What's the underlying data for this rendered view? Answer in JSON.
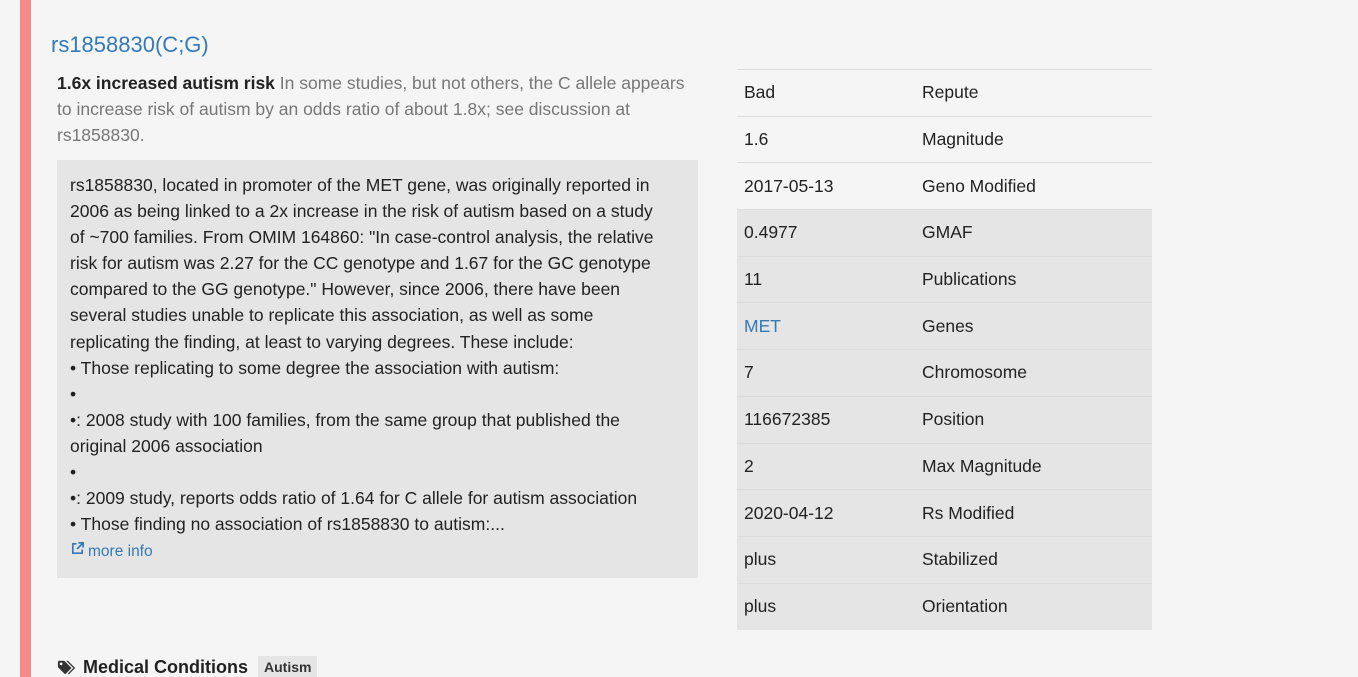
{
  "title": "rs1858830(C;G)",
  "summary": {
    "headline": "1.6x increased autism risk",
    "lines": [
      " In some studies, but not others, the C allele appears",
      "to increase risk of autism by an odds ratio of about 1.8x; see discussion at",
      "rs1858830."
    ]
  },
  "details": {
    "lines": [
      "rs1858830, located in promoter of the MET gene, was originally reported in",
      "2006 as being linked to a 2x increase in the risk of autism based on a study",
      "of ~700 families. From OMIM 164860: \"In case-control analysis, the relative",
      "risk for autism was 2.27 for the CC genotype and 1.67 for the GC genotype",
      "compared to the GG genotype.\" However, since 2006, there have been",
      "several studies unable to replicate this association, as well as some",
      "replicating the finding, at least to varying degrees. These include:",
      "• Those replicating to some degree the association with autism:",
      "•",
      "•: 2008 study with 100 families, from the same group that published the",
      "original 2006 association",
      "•",
      "•: 2009 study, reports odds ratio of 1.64 for C allele for autism association",
      "• Those finding no association of rs1858830 to autism:..."
    ],
    "more_info_label": "more info"
  },
  "attributes": [
    {
      "value": "Bad",
      "label": "Repute",
      "link": false
    },
    {
      "value": "1.6",
      "label": "Magnitude",
      "link": false
    },
    {
      "value": "2017-05-13",
      "label": "Geno Modified",
      "link": false
    },
    {
      "value": "0.4977",
      "label": "GMAF",
      "link": false
    },
    {
      "value": "11",
      "label": "Publications",
      "link": false
    },
    {
      "value": "MET",
      "label": "Genes",
      "link": true
    },
    {
      "value": "7",
      "label": "Chromosome",
      "link": false
    },
    {
      "value": "116672385",
      "label": "Position",
      "link": false
    },
    {
      "value": "2",
      "label": "Max Magnitude",
      "link": false
    },
    {
      "value": "2020-04-12",
      "label": "Rs Modified",
      "link": false
    },
    {
      "value": "plus",
      "label": "Stabilized",
      "link": false
    },
    {
      "value": "plus",
      "label": "Orientation",
      "link": false
    }
  ],
  "conditions": {
    "heading": "Medical Conditions",
    "tags": [
      "Autism"
    ]
  },
  "colors": {
    "accent_stripe": "#f48a8a",
    "link": "#337ab7",
    "panel": "#e5e5e5"
  },
  "icons": {
    "more_info": "external-link-icon",
    "conditions": "tags-icon"
  }
}
